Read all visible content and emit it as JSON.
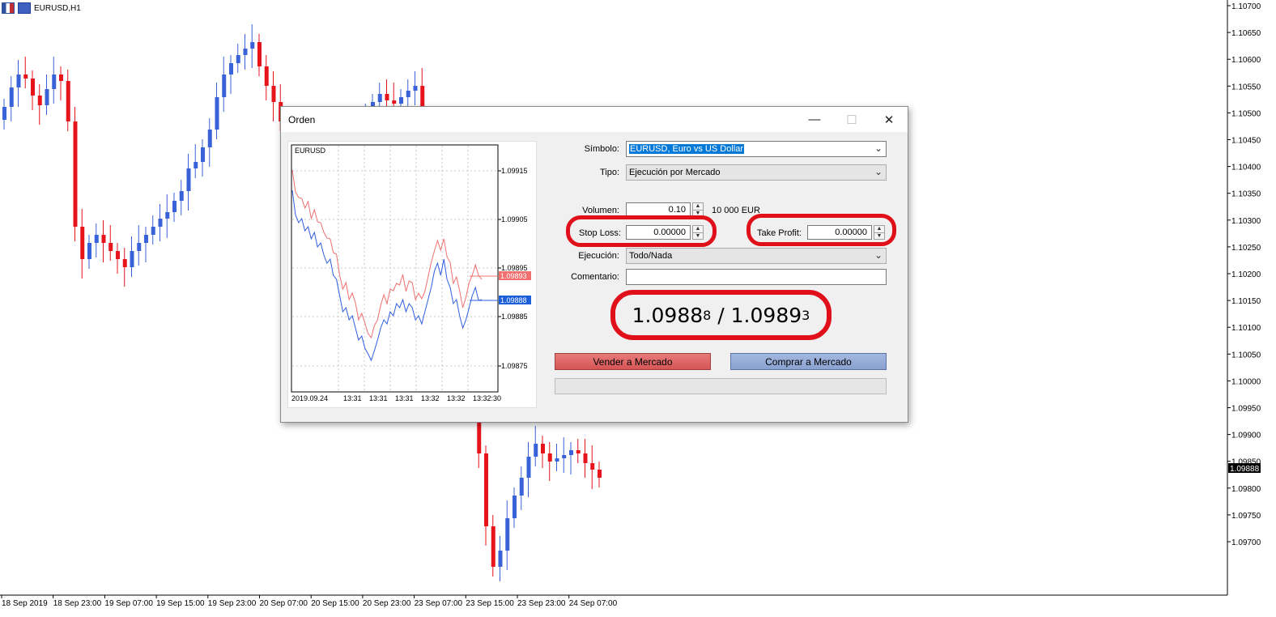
{
  "chart": {
    "title": "EURUSD,H1",
    "current_price_label": "1.09888",
    "price_axis": [
      "1.10700",
      "1.10650",
      "1.10600",
      "1.10550",
      "1.10500",
      "1.10450",
      "1.10400",
      "1.10350",
      "1.10300",
      "1.10250",
      "1.10200",
      "1.10150",
      "1.10100",
      "1.10050",
      "1.10000",
      "1.09950",
      "1.09900",
      "1.09850",
      "1.09800",
      "1.09750",
      "1.09700"
    ],
    "time_axis": [
      "18 Sep 2019",
      "18 Sep 23:00",
      "19 Sep 07:00",
      "19 Sep 15:00",
      "19 Sep 23:00",
      "20 Sep 07:00",
      "20 Sep 15:00",
      "20 Sep 23:00",
      "23 Sep 07:00",
      "23 Sep 15:00",
      "23 Sep 23:00",
      "24 Sep 07:00"
    ],
    "colors": {
      "bull": "#3a62d8",
      "bear": "#e8141c"
    }
  },
  "dialog": {
    "title": "Orden",
    "controls": {
      "minimize": "—",
      "maximize": "☐",
      "close": "✕"
    },
    "mini_chart": {
      "symbol": "EURUSD",
      "price_axis": [
        "1.09915",
        "1.09905",
        "1.09895",
        "1.09885",
        "1.09875"
      ],
      "time_axis": [
        "2019.09.24",
        "13:31",
        "13:31",
        "13:31",
        "13:32",
        "13:32",
        "13:32:30"
      ],
      "ask_label": "1.09893",
      "bid_label": "1.09888",
      "colors": {
        "ask": "#f07070",
        "bid": "#2e5ee0"
      }
    },
    "form": {
      "symbol_label": "Símbolo:",
      "symbol_value": "EURUSD, Euro vs US Dollar",
      "type_label": "Tipo:",
      "type_value": "Ejecución por Mercado",
      "volume_label": "Volumen:",
      "volume_value": "0.10",
      "volume_unit": "10 000 EUR",
      "stop_loss_label": "Stop Loss:",
      "stop_loss_value": "0.00000",
      "take_profit_label": "Take Profit:",
      "take_profit_value": "0.00000",
      "execution_label": "Ejecución:",
      "execution_value": "Todo/Nada",
      "comment_label": "Comentario:",
      "comment_value": ""
    },
    "quote": {
      "bid_main": "1.0988",
      "bid_small": "8",
      "separator": " / ",
      "ask_main": "1.0989",
      "ask_small": "3"
    },
    "buttons": {
      "sell": "Vender a Mercado",
      "buy": "Comprar a Mercado"
    },
    "highlight_color": "#e0101a"
  }
}
